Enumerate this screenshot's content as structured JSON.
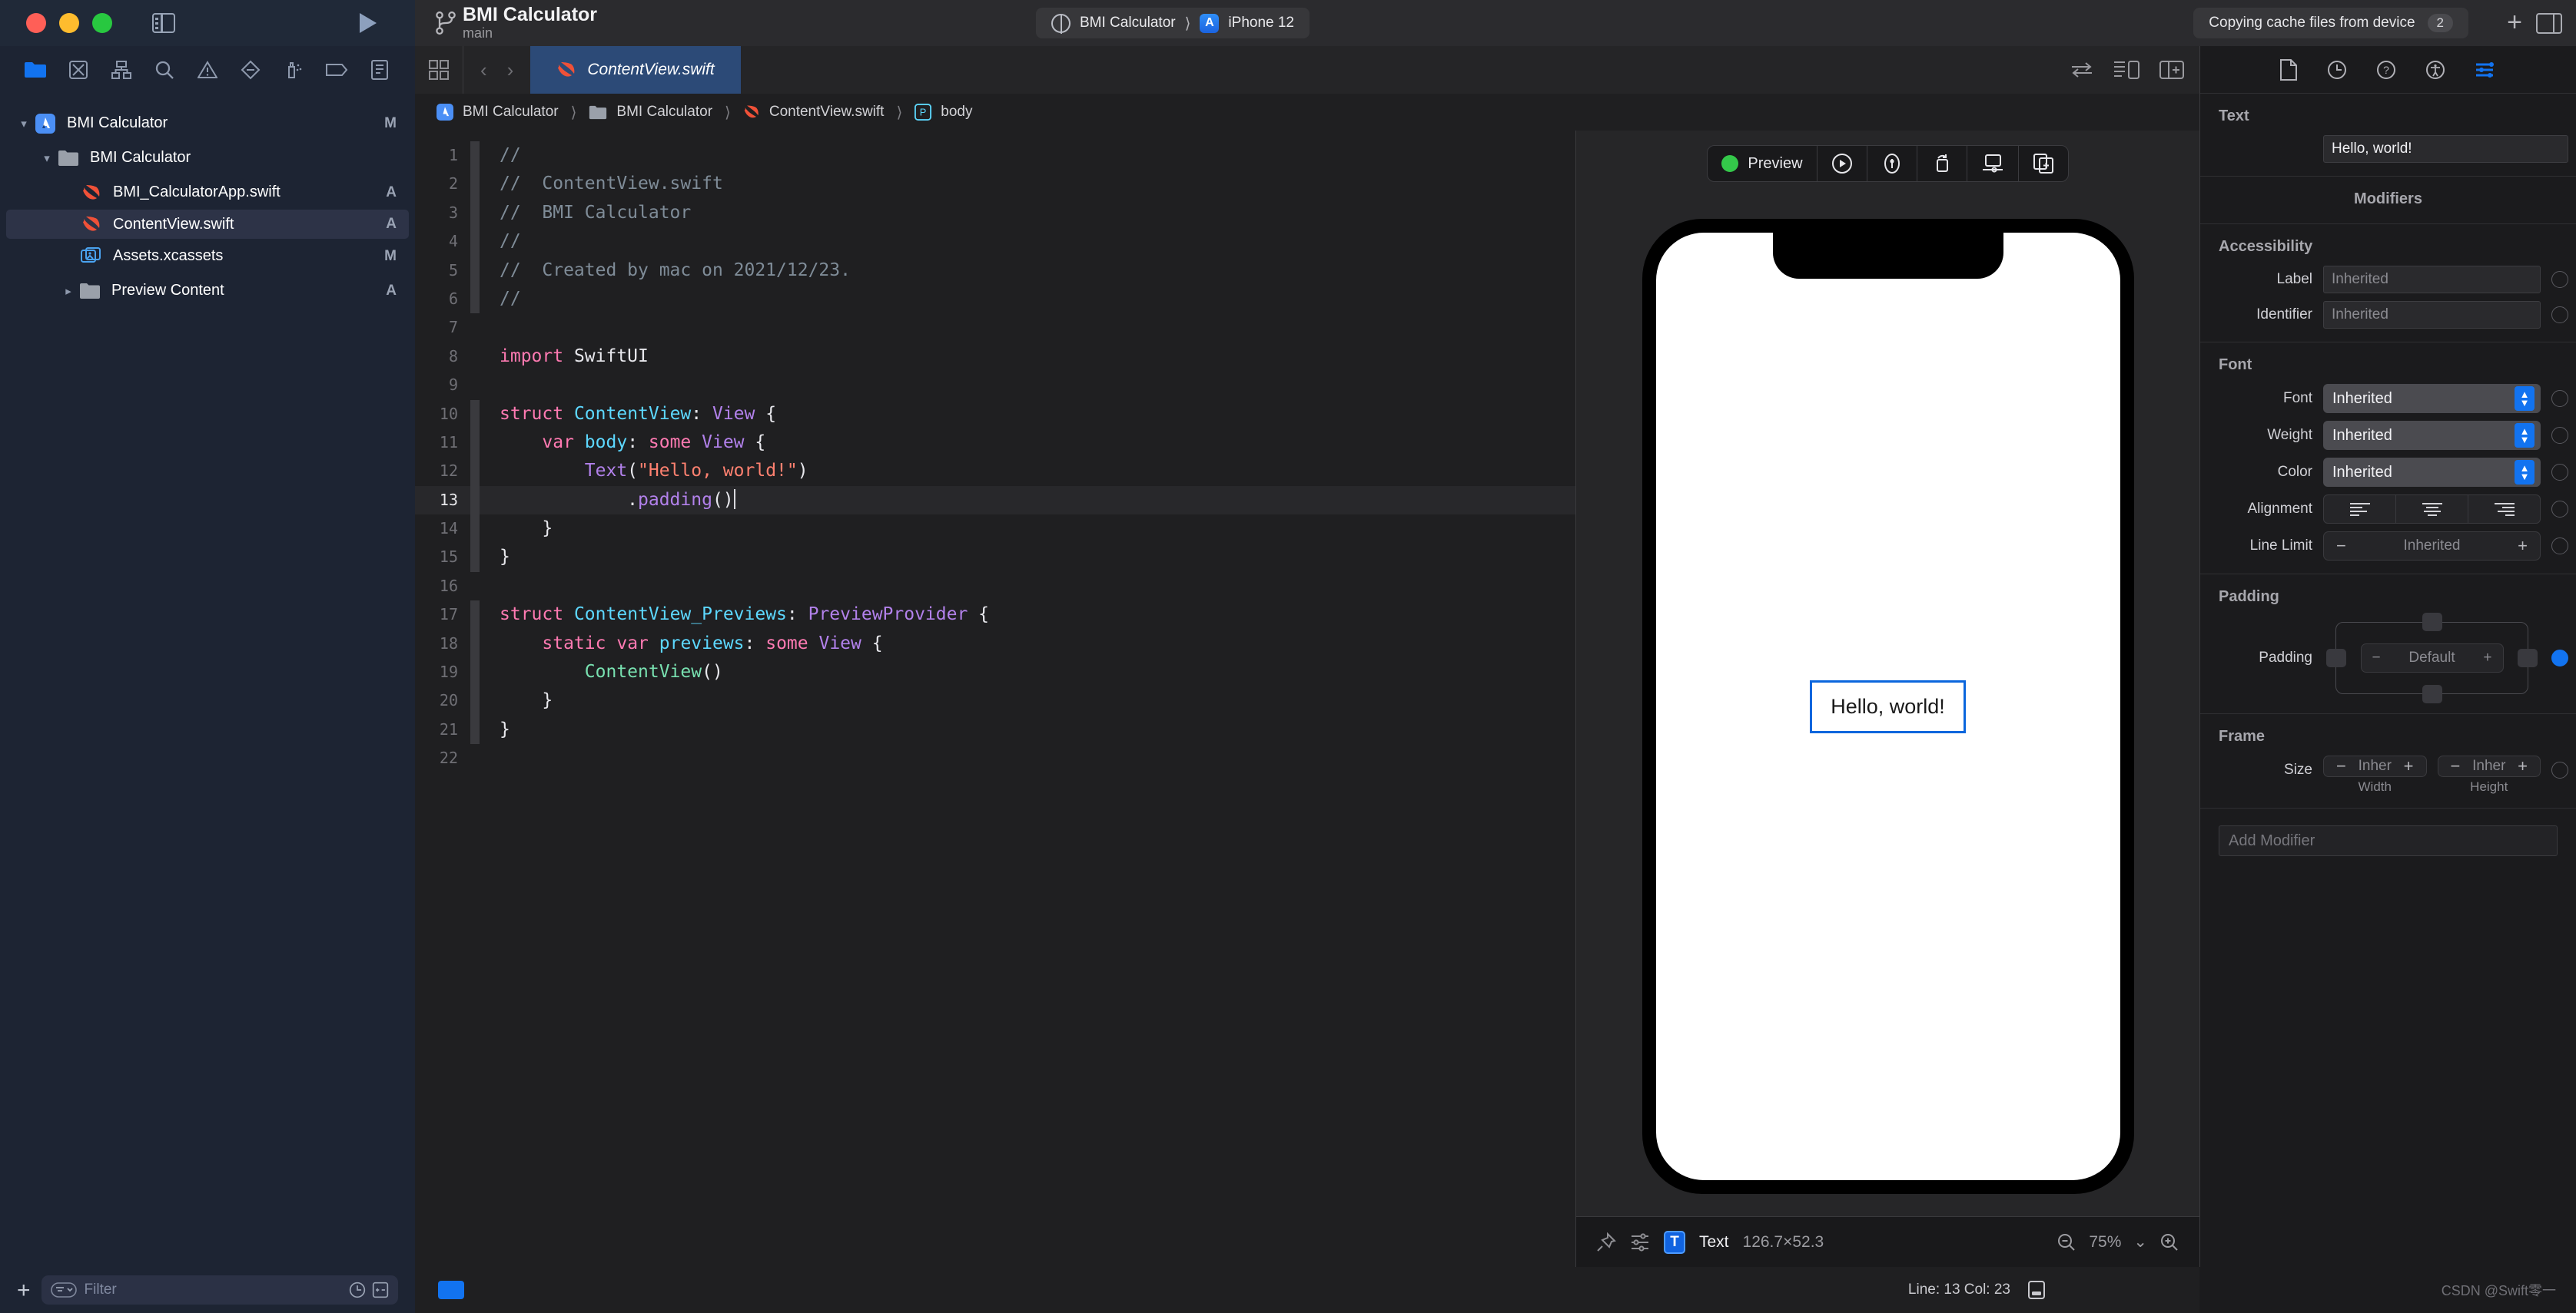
{
  "titlebar": {
    "project_name": "BMI Calculator",
    "branch": "main",
    "scheme_target": "BMI Calculator",
    "scheme_device": "iPhone 12",
    "activity_text": "Copying cache files from device",
    "activity_badge": "2",
    "run_button": "run-button",
    "add_button": "+"
  },
  "navigator": {
    "icons": [
      "folder-icon",
      "source-control-icon",
      "symbol-icon",
      "search-icon",
      "issue-icon",
      "test-icon",
      "debug-icon",
      "breakpoint-icon",
      "report-icon"
    ],
    "tree": [
      {
        "label": "BMI Calculator",
        "icon": "xcode-project-icon",
        "state": "M",
        "indent": 0,
        "twisty": "open"
      },
      {
        "label": "BMI Calculator",
        "icon": "folder-icon",
        "state": "",
        "indent": 1,
        "twisty": "open"
      },
      {
        "label": "BMI_CalculatorApp.swift",
        "icon": "swift-icon",
        "state": "A",
        "indent": 2,
        "twisty": ""
      },
      {
        "label": "ContentView.swift",
        "icon": "swift-icon",
        "state": "A",
        "indent": 2,
        "twisty": "",
        "selected": true
      },
      {
        "label": "Assets.xcassets",
        "icon": "assets-icon",
        "state": "M",
        "indent": 2,
        "twisty": ""
      },
      {
        "label": "Preview Content",
        "icon": "folder-icon",
        "state": "A",
        "indent": 2,
        "twisty": "closed"
      }
    ],
    "filter_placeholder": "Filter"
  },
  "editor": {
    "tab_label": "ContentView.swift",
    "breadcrumb": [
      {
        "label": "BMI Calculator",
        "icon": "xcode-project-icon"
      },
      {
        "label": "BMI Calculator",
        "icon": "folder-icon"
      },
      {
        "label": "ContentView.swift",
        "icon": "swift-icon"
      },
      {
        "label": "body",
        "icon": "property-icon"
      }
    ],
    "current_line": 13,
    "lines": [
      {
        "n": "1",
        "tokens": [
          {
            "t": "//",
            "c": "cm"
          }
        ]
      },
      {
        "n": "2",
        "tokens": [
          {
            "t": "//  ContentView.swift",
            "c": "cm"
          }
        ]
      },
      {
        "n": "3",
        "tokens": [
          {
            "t": "//  BMI Calculator",
            "c": "cm"
          }
        ]
      },
      {
        "n": "4",
        "tokens": [
          {
            "t": "//",
            "c": "cm"
          }
        ]
      },
      {
        "n": "5",
        "tokens": [
          {
            "t": "//  Created by mac on 2021/12/23.",
            "c": "cm"
          }
        ]
      },
      {
        "n": "6",
        "tokens": [
          {
            "t": "//",
            "c": "cm"
          }
        ]
      },
      {
        "n": "7",
        "tokens": []
      },
      {
        "n": "8",
        "tokens": [
          {
            "t": "import",
            "c": "kw"
          },
          {
            "t": " SwiftUI",
            "c": "pln"
          }
        ]
      },
      {
        "n": "9",
        "tokens": []
      },
      {
        "n": "10",
        "tokens": [
          {
            "t": "struct",
            "c": "kw"
          },
          {
            "t": " ",
            "c": "pln"
          },
          {
            "t": "ContentView",
            "c": "typ"
          },
          {
            "t": ": ",
            "c": "pln"
          },
          {
            "t": "View",
            "c": "pur"
          },
          {
            "t": " {",
            "c": "pln"
          }
        ]
      },
      {
        "n": "11",
        "tokens": [
          {
            "t": "    ",
            "c": "pln"
          },
          {
            "t": "var",
            "c": "kw"
          },
          {
            "t": " ",
            "c": "pln"
          },
          {
            "t": "body",
            "c": "typ"
          },
          {
            "t": ": ",
            "c": "pln"
          },
          {
            "t": "some",
            "c": "kw"
          },
          {
            "t": " ",
            "c": "pln"
          },
          {
            "t": "View",
            "c": "pur"
          },
          {
            "t": " {",
            "c": "pln"
          }
        ]
      },
      {
        "n": "12",
        "tokens": [
          {
            "t": "        ",
            "c": "pln"
          },
          {
            "t": "Text",
            "c": "pur"
          },
          {
            "t": "(",
            "c": "pln"
          },
          {
            "t": "\"Hello, world!\"",
            "c": "str"
          },
          {
            "t": ")",
            "c": "pln"
          }
        ]
      },
      {
        "n": "13",
        "tokens": [
          {
            "t": "            .",
            "c": "pln"
          },
          {
            "t": "padding",
            "c": "pur"
          },
          {
            "t": "()",
            "c": "pln"
          }
        ]
      },
      {
        "n": "14",
        "tokens": [
          {
            "t": "    }",
            "c": "pln"
          }
        ]
      },
      {
        "n": "15",
        "tokens": [
          {
            "t": "}",
            "c": "pln"
          }
        ]
      },
      {
        "n": "16",
        "tokens": []
      },
      {
        "n": "17",
        "tokens": [
          {
            "t": "struct",
            "c": "kw"
          },
          {
            "t": " ",
            "c": "pln"
          },
          {
            "t": "ContentView_Previews",
            "c": "typ"
          },
          {
            "t": ": ",
            "c": "pln"
          },
          {
            "t": "PreviewProvider",
            "c": "pur"
          },
          {
            "t": " {",
            "c": "pln"
          }
        ]
      },
      {
        "n": "18",
        "tokens": [
          {
            "t": "    ",
            "c": "pln"
          },
          {
            "t": "static",
            "c": "kw"
          },
          {
            "t": " ",
            "c": "pln"
          },
          {
            "t": "var",
            "c": "kw"
          },
          {
            "t": " ",
            "c": "pln"
          },
          {
            "t": "previews",
            "c": "typ"
          },
          {
            "t": ": ",
            "c": "pln"
          },
          {
            "t": "some",
            "c": "kw"
          },
          {
            "t": " ",
            "c": "pln"
          },
          {
            "t": "View",
            "c": "pur"
          },
          {
            "t": " {",
            "c": "pln"
          }
        ]
      },
      {
        "n": "19",
        "tokens": [
          {
            "t": "        ",
            "c": "pln"
          },
          {
            "t": "ContentView",
            "c": "grn"
          },
          {
            "t": "()",
            "c": "pln"
          }
        ]
      },
      {
        "n": "20",
        "tokens": [
          {
            "t": "    }",
            "c": "pln"
          }
        ]
      },
      {
        "n": "21",
        "tokens": [
          {
            "t": "}",
            "c": "pln"
          }
        ]
      },
      {
        "n": "22",
        "tokens": []
      }
    ]
  },
  "canvas": {
    "preview_label": "Preview",
    "toolbar_icons": [
      "live-preview-icon",
      "inspect-preview-icon",
      "rotate-device-icon",
      "device-settings-icon",
      "duplicate-preview-icon"
    ],
    "preview_text": "Hello, world!",
    "selection_name": "Text",
    "selection_size": "126.7×52.3",
    "zoom_level": "75%"
  },
  "inspector": {
    "tabs": [
      "file-inspector-icon",
      "history-inspector-icon",
      "quick-help-icon",
      "accessibility-inspector-icon",
      "attributes-inspector-icon"
    ],
    "active_tab": 4,
    "text_section": {
      "title": "Text",
      "value": "Hello, world!"
    },
    "modifiers_title": "Modifiers",
    "accessibility": {
      "title": "Accessibility",
      "fields": [
        {
          "label": "Label",
          "placeholder": "Inherited"
        },
        {
          "label": "Identifier",
          "placeholder": "Inherited"
        }
      ]
    },
    "font": {
      "title": "Font",
      "font_label": "Font",
      "font_value": "Inherited",
      "weight_label": "Weight",
      "weight_value": "Inherited",
      "color_label": "Color",
      "color_value": "Inherited",
      "alignment_label": "Alignment",
      "alignment_options": [
        "align-left-icon",
        "align-center-icon",
        "align-right-icon"
      ],
      "line_limit_label": "Line Limit",
      "line_limit_value": "Inherited",
      "minus": "−",
      "plus": "+"
    },
    "padding": {
      "title": "Padding",
      "label": "Padding",
      "value": "Default",
      "minus": "−",
      "plus": "+"
    },
    "frame": {
      "title": "Frame",
      "size_label": "Size",
      "width_value": "Inher",
      "width_caption": "Width",
      "height_value": "Inher",
      "height_caption": "Height",
      "minus": "−",
      "plus": "+"
    },
    "add_modifier_placeholder": "Add Modifier"
  },
  "statusbar": {
    "line_col": "Line: 13  Col: 23",
    "watermark": "CSDN @Swift零一"
  }
}
